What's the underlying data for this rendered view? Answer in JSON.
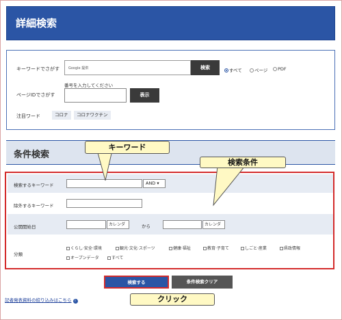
{
  "header": {
    "title": "詳細検索"
  },
  "keyword_search": {
    "label": "キーワードでさがす",
    "input_value": "Google 提供",
    "search_button": "検索",
    "radios": [
      {
        "label": "すべて",
        "checked": true
      },
      {
        "label": "ページ",
        "checked": false
      },
      {
        "label": "PDF",
        "checked": false
      }
    ]
  },
  "page_id_search": {
    "label": "ページIDでさがす",
    "hint": "番号を入力してください",
    "input_value": "",
    "display_button": "表示"
  },
  "attention_words": {
    "label": "注目ワード",
    "tags": [
      "コロナ",
      "コロナワクチン"
    ]
  },
  "condition_search": {
    "title": "条件検索",
    "keyword_row": {
      "label": "検索するキーワード",
      "input_value": "",
      "operator": "AND ▾"
    },
    "exclude_row": {
      "label": "除外するキーワード",
      "input_value": ""
    },
    "date_row": {
      "label": "公開開始日",
      "calendar_label": "カレンダ",
      "from_text": "から"
    },
    "category_row": {
      "label": "分類",
      "options": [
        "くらし·安全·環境",
        "観光·文化·スポーツ",
        "健康·福祉",
        "教育·子育て",
        "しごと·産業",
        "県政情報",
        "オープンデータ",
        "すべて"
      ]
    }
  },
  "actions": {
    "search": "検索する",
    "clear": "条件検索クリア"
  },
  "footer_link": {
    "label": "記者発表資料の絞り込みはこちら",
    "icon": "info-icon"
  },
  "annotations": {
    "keyword": "キーワード",
    "conditions": "検索条件",
    "click": "クリック"
  },
  "colors": {
    "brand": "#2b55a5",
    "highlight": "#d32a2a",
    "callout": "#fff9c4"
  }
}
